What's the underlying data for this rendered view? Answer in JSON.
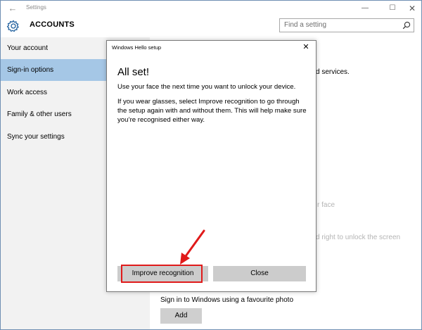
{
  "window": {
    "title": "Settings",
    "back_glyph": "←",
    "minimize_glyph": "—",
    "maximize_glyph": "☐",
    "close_glyph": "✕"
  },
  "header": {
    "icon": "gear-icon",
    "title": "ACCOUNTS",
    "search_placeholder": "Find a setting",
    "search_icon": "search-icon"
  },
  "sidebar": {
    "items": [
      {
        "label": "Your account",
        "selected": false
      },
      {
        "label": "Sign-in options",
        "selected": true
      },
      {
        "label": "Work access",
        "selected": false
      },
      {
        "label": "Family & other users",
        "selected": false
      },
      {
        "label": "Sync your settings",
        "selected": false
      }
    ],
    "selected_color": "#a5c7e6"
  },
  "main": {
    "partial_text_1": "d services.",
    "partial_text_2": "r face",
    "partial_text_3": "d right to unlock the screen",
    "picture_password_text": "Sign in to Windows using a favourite photo",
    "add_button": "Add"
  },
  "dialog": {
    "title": "Windows Hello setup",
    "close_glyph": "✕",
    "heading": "All set!",
    "paragraph_1": "Use your face the next time you want to unlock your device.",
    "paragraph_2": "If you wear glasses, select Improve recognition to go through the setup again with and without them. This will help make sure you’re recognised either way.",
    "improve_button": "Improve recognition",
    "close_button": "Close"
  },
  "annotation": {
    "color": "#e01a1a"
  }
}
